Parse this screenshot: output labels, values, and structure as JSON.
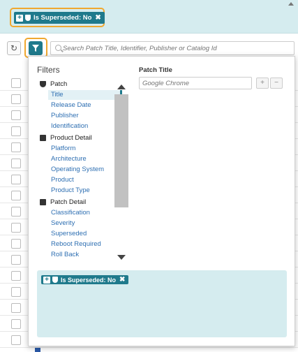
{
  "active_filter_chip": {
    "label": "Is Superseded: No",
    "remove_glyph": "✖",
    "add_glyph": "+"
  },
  "toolbar": {
    "refresh_glyph": "↻",
    "search_placeholder": "Search Patch Title, Identifier, Publisher or Catalog Id"
  },
  "filters_panel": {
    "title": "Filters",
    "field_label": "Patch Title",
    "field_placeholder": "Google Chrome",
    "add_button": "+",
    "remove_button": "−",
    "tree": [
      {
        "category": "Patch",
        "icon": "shield-icon",
        "items": [
          "Title",
          "Release Date",
          "Publisher",
          "Identification"
        ]
      },
      {
        "category": "Product Detail",
        "icon": "box-icon",
        "items": [
          "Platform",
          "Architecture",
          "Operating System",
          "Product",
          "Product Type"
        ]
      },
      {
        "category": "Patch Detail",
        "icon": "card-icon",
        "items": [
          "Classification",
          "Severity",
          "Superseded",
          "Reboot Required",
          "Roll Back"
        ]
      }
    ],
    "selected_item": "Title",
    "applied_chip_label": "Is Superseded: No"
  },
  "colors": {
    "accent": "#1f7a8c",
    "highlight_outline": "#f0a830",
    "chip_area_bg": "#d5ecef",
    "link": "#2e6fb2"
  }
}
